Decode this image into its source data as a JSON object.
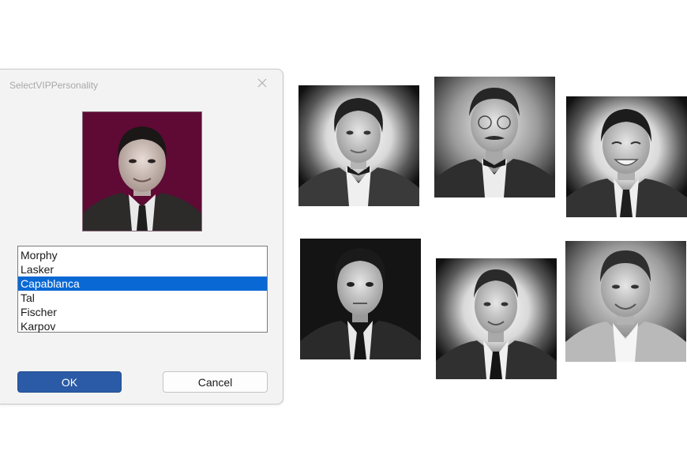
{
  "dialog": {
    "title": "SelectVIPPersonality",
    "close_icon": "close-icon",
    "preview_image": "portrait-capablanca",
    "preview_bg": "#5e0a34",
    "list": {
      "items": [
        "Morphy",
        "Lasker",
        "Capablanca",
        "Tal",
        "Fischer",
        "Karpov"
      ],
      "selected": "Capablanca"
    },
    "ok_label": "OK",
    "cancel_label": "Cancel"
  },
  "colors": {
    "selection": "#0a68d4",
    "ok_button": "#2b5aa6"
  },
  "gallery": {
    "portraits": [
      "portrait-morphy",
      "portrait-lasker",
      "portrait-capablanca",
      "portrait-tal",
      "portrait-fischer",
      "portrait-karpov"
    ]
  }
}
